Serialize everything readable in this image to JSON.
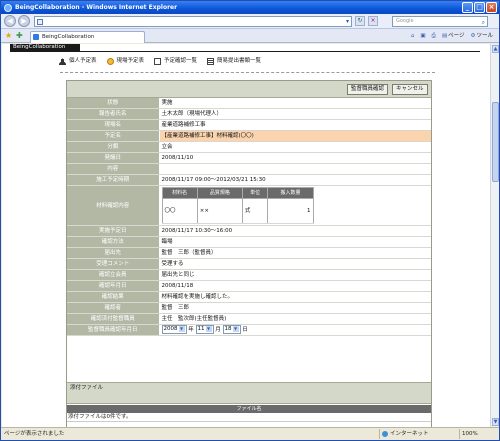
{
  "window": {
    "title": "BeingCollaboration - Windows Internet Explorer"
  },
  "browser": {
    "search_placeholder": "Google",
    "tab_label": "BeingCollaboration",
    "tools": [
      "ページ",
      "ツール"
    ]
  },
  "page": {
    "header_text": "BeingCollaboration"
  },
  "nav": {
    "items": [
      {
        "label": "個人予定表",
        "icon": "person-icon"
      },
      {
        "label": "現場予定表",
        "icon": "bubble-icon"
      },
      {
        "label": "予定確認一覧",
        "icon": "document-icon"
      },
      {
        "label": "簡易提出書類一覧",
        "icon": "list-icon"
      }
    ]
  },
  "buttons": {
    "supervisor_confirm": "監督職員確認",
    "cancel": "キャンセル"
  },
  "form": {
    "status": {
      "label": "状態",
      "value": "実施"
    },
    "reporter": {
      "label": "報告者氏名",
      "value": "土木太郎（現場代理人）"
    },
    "site": {
      "label": "現場名",
      "value": "産業道路補修工事"
    },
    "schedule_name": {
      "label": "予定名",
      "value": "【産業道路補修工事】材料確認(〇〇)"
    },
    "category": {
      "label": "分類",
      "value": "立会"
    },
    "issue_date": {
      "label": "発議日",
      "value": "2008/11/10"
    },
    "content": {
      "label": "内容",
      "value": ""
    },
    "construction_period": {
      "label": "施工予定時期",
      "value": "2008/11/17 09:00～2012/03/21 15:30"
    },
    "materials": {
      "label": "材料確認内容",
      "headers": [
        "材料名",
        "品質規格",
        "単位",
        "搬入数量"
      ],
      "rows": [
        [
          "〇〇",
          "××",
          "式",
          "1"
        ]
      ]
    },
    "planned_date": {
      "label": "実施予定日",
      "value": "2008/11/17 10:30～16:00"
    },
    "method": {
      "label": "確認方法",
      "value": "臨場"
    },
    "submit_to": {
      "label": "届出先",
      "value": "監督　三郎（監督員）"
    },
    "receipt_comment": {
      "label": "受理コメント",
      "value": "受理する"
    },
    "witness": {
      "label": "確認立会員",
      "value": "届出先と同じ"
    },
    "confirm_date": {
      "label": "確認年月日",
      "value": "2008/11/18"
    },
    "result": {
      "label": "確認結果",
      "value": "材料確認を実施し確認した。"
    },
    "confirmer": {
      "label": "確認者",
      "value": "監督　三郎"
    },
    "chief_supervisor": {
      "label": "確認済付監督職員",
      "value": "主任　監次郎(主任監督員)"
    },
    "supervisor_confirm_date": {
      "label": "監督職員確認年月日",
      "year": "2008",
      "year_unit": "年",
      "month": "11",
      "month_unit": "月",
      "day": "18",
      "day_unit": "日"
    }
  },
  "attachments": {
    "title": "添付ファイル",
    "column": "ファイル名",
    "empty_text": "添付ファイルは0件です。"
  },
  "statusbar": {
    "status": "ページが表示されました",
    "zone": "インターネット",
    "zoom": "100%"
  }
}
